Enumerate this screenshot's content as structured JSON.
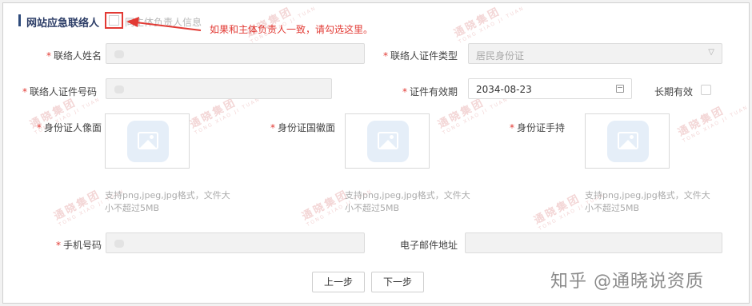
{
  "section": {
    "title": "网站应急联络人",
    "same_as_label": "同主体负责人信息",
    "hint": "如果和主体负责人一致，请勾选这里。"
  },
  "fields": {
    "name_label": "联络人姓名",
    "id_type_label": "联络人证件类型",
    "id_type_value": "居民身份证",
    "id_number_label": "联络人证件号码",
    "validity_label": "证件有效期",
    "validity_value": "2034-08-23",
    "long_term_label": "长期有效",
    "phone_label": "手机号码",
    "email_label": "电子邮件地址"
  },
  "uploads": {
    "front_label": "身份证人像面",
    "back_label": "身份证国徽面",
    "hand_label": "身份证手持",
    "tip_line1": "支持png,jpeg,jpg格式，文件大",
    "tip_line2": "小不超过5MB"
  },
  "required_mark": "*",
  "buttons": {
    "prev": "上一步",
    "next": "下一步"
  },
  "watermark": {
    "text": "通晓集团",
    "sub": "TONG XIAO JI TUAN"
  },
  "brand": "知乎 @通晓说资质",
  "colors": {
    "accent_red": "#e23a34",
    "title_navy": "#2b3c66"
  }
}
